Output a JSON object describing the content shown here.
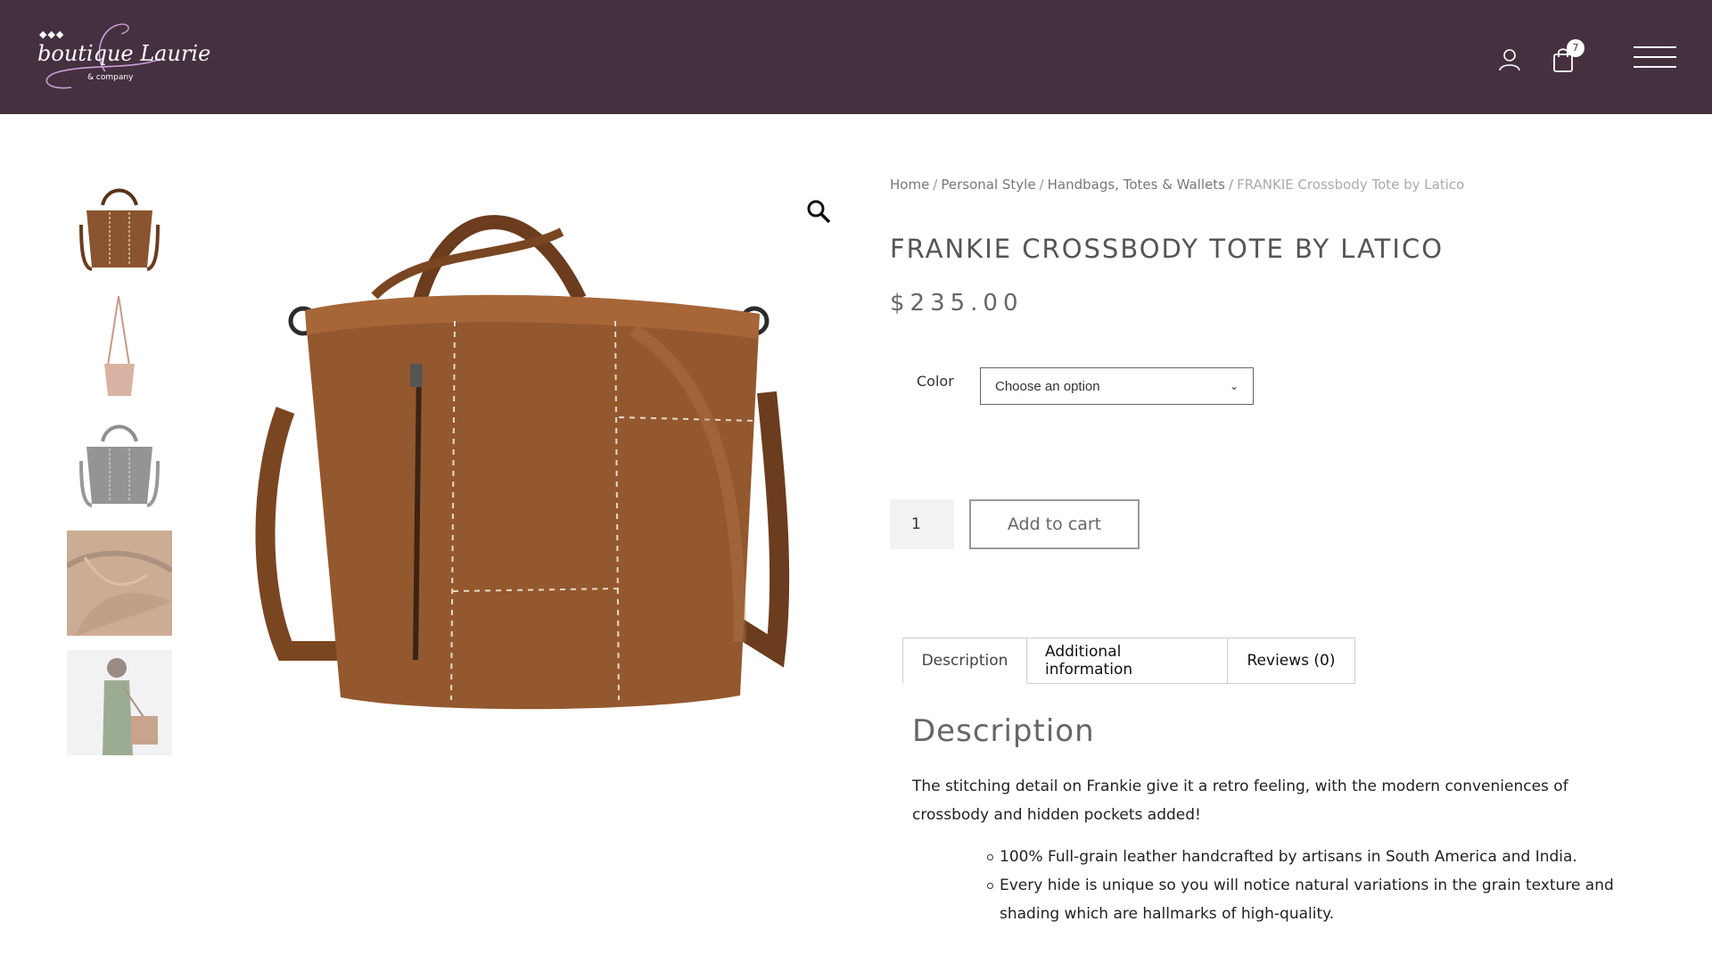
{
  "header": {
    "logo_text": "boutique Laurie",
    "logo_sub": "& company",
    "cart_count": "7",
    "background": "#45303f"
  },
  "icons": {
    "user": "user-icon",
    "cart": "cart-icon",
    "menu": "hamburger-menu-icon",
    "zoom": "magnifier-icon"
  },
  "breadcrumb": {
    "home": "Home",
    "personal_style": "Personal Style",
    "category": "Handbags, Totes & Wallets",
    "current": "FRANKIE Crossbody Tote by Latico",
    "separator": "/"
  },
  "product": {
    "title": "FRANKIE CROSSBODY TOTE BY LATICO",
    "price": "$235.00",
    "color_label": "Color",
    "color_placeholder": "Choose an option",
    "quantity": "1",
    "add_to_cart": "Add to cart"
  },
  "tabs": {
    "description": "Description",
    "additional": "Additional information",
    "reviews": "Reviews (0)"
  },
  "description": {
    "heading": "Description",
    "paragraph": "The stitching detail on Frankie give it a retro feeling, with the modern conveniences of crossbody and hidden pockets  added!",
    "bullets": [
      "100% Full-grain leather handcrafted by artisans in South America and India.",
      "Every hide is unique so you will notice natural variations in the grain texture and shading which are hallmarks of high-quality."
    ]
  }
}
